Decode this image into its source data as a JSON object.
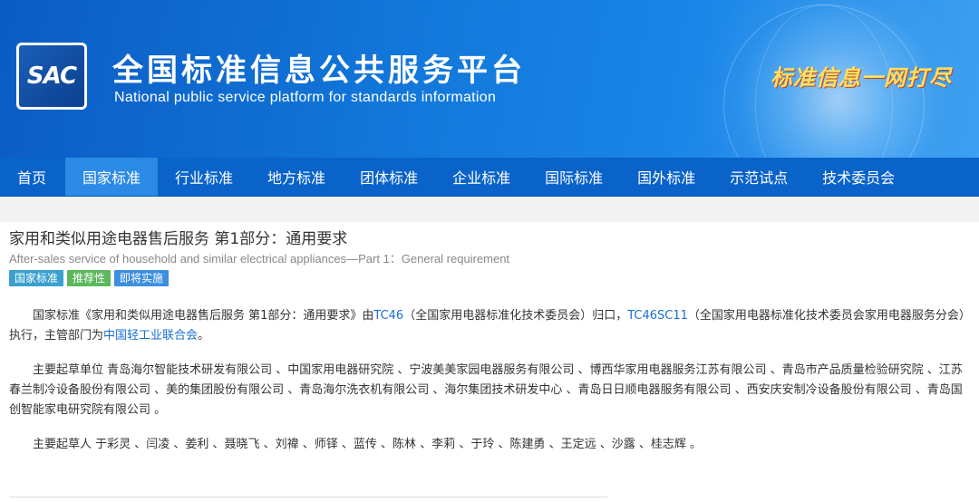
{
  "header": {
    "logo_text": "SAC",
    "title": "全国标准信息公共服务平台",
    "subtitle": "National public service platform  for standards information",
    "slogan": "标准信息一网打尽"
  },
  "nav": {
    "items": [
      "首页",
      "国家标准",
      "行业标准",
      "地方标准",
      "团体标准",
      "企业标准",
      "国际标准",
      "国外标准",
      "示范试点",
      "技术委员会"
    ],
    "active_index": 1
  },
  "standard": {
    "title": "家用和类似用途电器售后服务 第1部分：通用要求",
    "title_en": "After-sales service of household and similar electrical appliances—Part 1：General requirement",
    "tags": [
      "国家标准",
      "推荐性",
      "即将实施"
    ]
  },
  "para1": {
    "t1": "国家标准《家用和类似用途电器售后服务 第1部分：通用要求》由",
    "link1": "TC46",
    "t2": "（全国家用电器标准化技术委员会）归口，",
    "link2": "TC46SC11",
    "t3": "（全国家用电器标准化技术委员会家用电器服务分会）执行，主管部门为",
    "link3": "中国轻工业联合会",
    "t4": "。"
  },
  "para2": "主要起草单位 青岛海尔智能技术研发有限公司 、中国家用电器研究院 、宁波美美家园电器服务有限公司 、博西华家用电器服务江苏有限公司 、青岛市产品质量检验研究院 、江苏春兰制冷设备股份有限公司 、美的集团股份有限公司 、青岛海尔洗衣机有限公司 、海尔集团技术研发中心 、青岛日日顺电器服务有限公司 、西安庆安制冷设备股份有限公司 、青岛国创智能家电研究院有限公司 。",
  "para3": "主要起草人 于彩灵 、闫凌 、姜利 、聂晓飞 、刘禕 、师铎 、蓝传 、陈林 、李莉 、于玲 、陈建勇 、王定远 、沙露 、桂志辉 。",
  "colors": {
    "nav_bg": "#0a63c9",
    "nav_active": "#2b8ae6",
    "link": "#1a6fd0"
  }
}
